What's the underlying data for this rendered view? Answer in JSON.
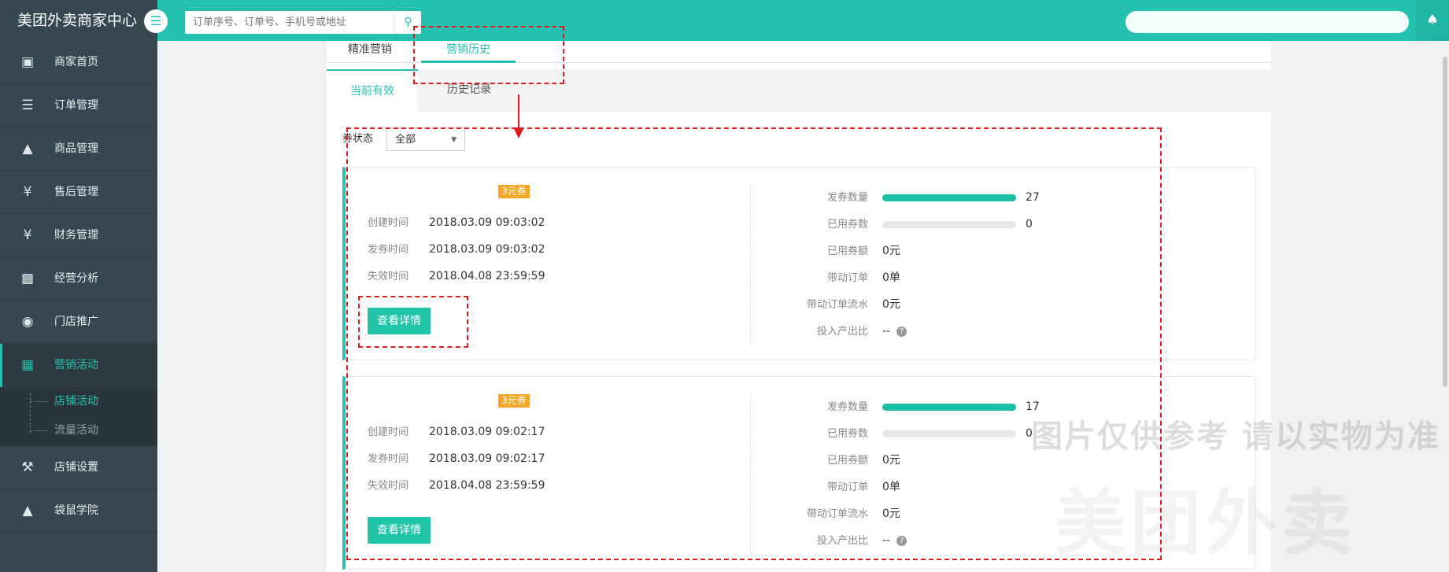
{
  "app": {
    "title": "美团外卖商家中心"
  },
  "search": {
    "placeholder": "订单序号、订单号、手机号或地址"
  },
  "sidebar": {
    "items": [
      {
        "label": "商家首页",
        "icon": "store-icon"
      },
      {
        "label": "订单管理",
        "icon": "clipboard-icon"
      },
      {
        "label": "商品管理",
        "icon": "dish-icon"
      },
      {
        "label": "售后管理",
        "icon": "yen-service-icon"
      },
      {
        "label": "财务管理",
        "icon": "yen-icon"
      },
      {
        "label": "经营分析",
        "icon": "chart-icon"
      },
      {
        "label": "门店推广",
        "icon": "money-bag-icon"
      },
      {
        "label": "营销活动",
        "icon": "gift-icon"
      },
      {
        "label": "店铺设置",
        "icon": "wrench-icon"
      },
      {
        "label": "袋鼠学院",
        "icon": "graduation-cap-icon"
      }
    ],
    "subitems": [
      {
        "label": "店铺活动"
      },
      {
        "label": "流量活动"
      }
    ]
  },
  "tabs": {
    "main": [
      {
        "label": "精准营销"
      },
      {
        "label": "营销历史"
      }
    ],
    "sub": [
      {
        "label": "当前有效"
      },
      {
        "label": "历史记录"
      }
    ]
  },
  "filter": {
    "label": "券状态",
    "value": "全部"
  },
  "labels": {
    "created": "创建时间",
    "issued": "发券时间",
    "expires": "失效时间",
    "detail_button": "查看详情",
    "issued_count": "发券数量",
    "used_count": "已用券数",
    "used_amount": "已用券额",
    "orders": "带动订单",
    "order_revenue": "带动订单流水",
    "roi": "投入产出比"
  },
  "coupons": [
    {
      "badge": "3元券",
      "created": "2018.03.09 09:03:02",
      "issued": "2018.03.09 09:03:02",
      "expires": "2018.04.08 23:59:59",
      "issued_count": "27",
      "issued_fill": 1.0,
      "used_count": "0",
      "used_fill": 0,
      "used_amount": "0元",
      "orders": "0单",
      "order_revenue": "0元",
      "roi": "--"
    },
    {
      "badge": "3元券",
      "created": "2018.03.09 09:02:17",
      "issued": "2018.03.09 09:02:17",
      "expires": "2018.04.08 23:59:59",
      "issued_count": "17",
      "issued_fill": 1.0,
      "used_count": "0",
      "used_fill": 0,
      "used_amount": "0元",
      "orders": "0单",
      "order_revenue": "0元",
      "roi": "--"
    }
  ],
  "watermark": {
    "text": "图片仅供参考 请以实物为准",
    "logo": "美团外卖"
  },
  "colors": {
    "accent": "#25c1b0",
    "sidebar": "#37474f",
    "badge": "#f5a623",
    "annotation": "#e01b1b"
  }
}
